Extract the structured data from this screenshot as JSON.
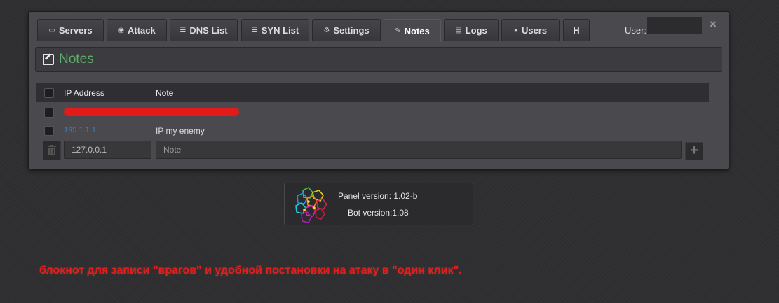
{
  "tabs": [
    {
      "label": "Servers",
      "icon": "server-icon"
    },
    {
      "label": "Attack",
      "icon": "dashboard-icon"
    },
    {
      "label": "DNS List",
      "icon": "list-icon"
    },
    {
      "label": "SYN List",
      "icon": "list-icon"
    },
    {
      "label": "Settings",
      "icon": "cogs-icon"
    },
    {
      "label": "Notes",
      "icon": "edit-icon",
      "active": true
    },
    {
      "label": "Logs",
      "icon": "file-icon"
    },
    {
      "label": "Users",
      "icon": "user-icon"
    },
    {
      "label": "H"
    }
  ],
  "user": {
    "label": "User:"
  },
  "close": "×",
  "notes": {
    "title": "Notes"
  },
  "table": {
    "columns": [
      "IP Address",
      "Note"
    ],
    "rows": [
      {
        "ip": "",
        "note": "",
        "redacted": true
      },
      {
        "ip": "195.1.1.1",
        "note": "IP my enemy"
      }
    ]
  },
  "add_form": {
    "ip_value": "127.0.0.1",
    "note_placeholder": "Note",
    "add_button": "+"
  },
  "version": {
    "panel": "Panel version: 1.02-b",
    "bot": "Bot version:1.08"
  },
  "caption": "блокнот для записи \"врагов\" и удобной постановки на атаку в \"один клик\".",
  "colors": {
    "accent_green": "#5fae6a",
    "link_blue": "#3b82c4",
    "caption_red": "#e0201c"
  }
}
